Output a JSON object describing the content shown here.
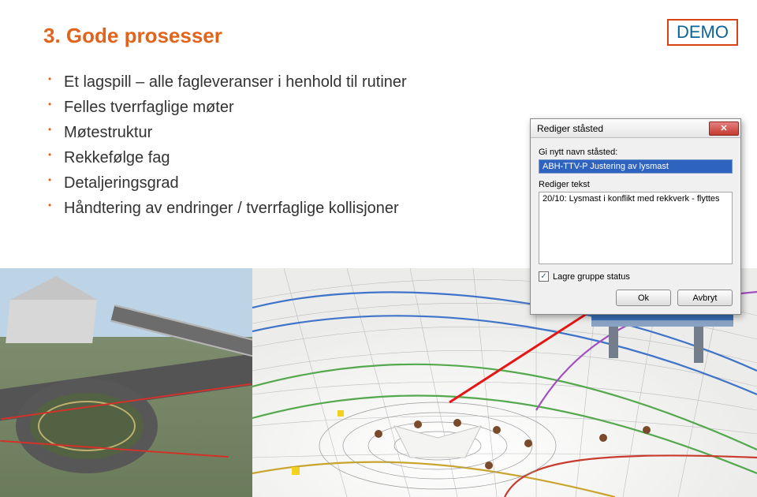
{
  "title": "3. Gode prosesser",
  "demo_badge": "DEMO",
  "bullets": [
    "Et lagspill – alle fagleveranser i henhold til rutiner",
    "Felles tverrfaglige møter",
    "Møtestruktur",
    "Rekkefølge fag",
    "Detaljeringsgrad",
    "Håndtering av endringer / tverrfaglige kollisjoner"
  ],
  "dialog": {
    "title": "Rediger ståsted",
    "label_name": "Gi nytt navn ståsted:",
    "name_value": "ABH-TTV-P Justering av lysmast",
    "label_text": "Rediger tekst",
    "text_value": "20/10: Lysmast i konflikt med rekkverk - flyttes",
    "checkbox_label": "Lagre gruppe status",
    "checkbox_checked": true,
    "ok": "Ok",
    "cancel": "Avbryt"
  },
  "icons": {
    "close_glyph": "✕",
    "check_glyph": "✓"
  }
}
